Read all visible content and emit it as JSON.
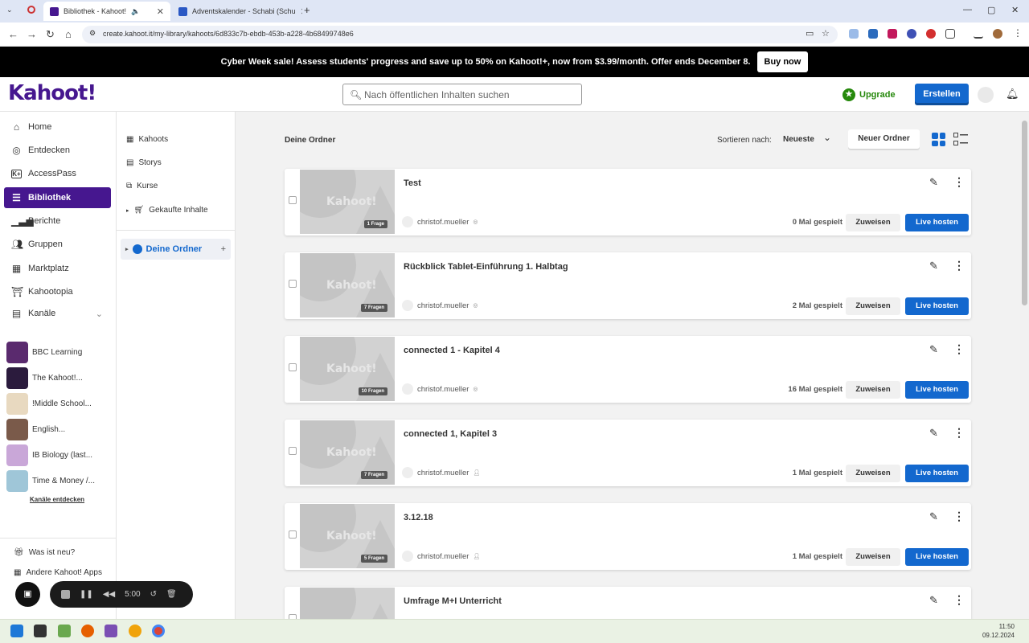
{
  "browser": {
    "tabs": [
      {
        "title": "Bibliothek - Kahoot!",
        "active": true
      },
      {
        "title": "Adventskalender - Schabi (Schu",
        "active": false
      }
    ],
    "url": "create.kahoot.it/my-library/kahoots/6d833c7b-ebdb-453b-a228-4b68499748e6"
  },
  "promo": {
    "text": "Cyber Week sale! Assess students' progress and save up to 50% on Kahoot!+, now from $3.99/month. Offer ends December 8.",
    "button": "Buy now"
  },
  "header": {
    "logo": "Kahoot!",
    "search_placeholder": "Nach öffentlichen Inhalten suchen",
    "upgrade": "Upgrade",
    "create": "Erstellen"
  },
  "leftnav": {
    "items": [
      {
        "label": "Home",
        "icon": "home-icon"
      },
      {
        "label": "Entdecken",
        "icon": "compass-icon"
      },
      {
        "label": "AccessPass",
        "icon": "accesspass-icon"
      },
      {
        "label": "Bibliothek",
        "icon": "list-icon",
        "active": true
      },
      {
        "label": "Berichte",
        "icon": "bar-chart-icon"
      },
      {
        "label": "Gruppen",
        "icon": "group-icon"
      },
      {
        "label": "Marktplatz",
        "icon": "store-icon"
      },
      {
        "label": "Kahootopia",
        "icon": "landmark-icon"
      },
      {
        "label": "Kanäle",
        "icon": "channels-icon"
      }
    ],
    "channels": [
      {
        "label": "BBC Learning",
        "color": "#5a2a6e"
      },
      {
        "label": "The Kahoot!...",
        "color": "#2b1b3d"
      },
      {
        "label": "!Middle School...",
        "color": "#e8d9c0"
      },
      {
        "label": "English...",
        "color": "#7a5a4a"
      },
      {
        "label": "IB Biology (last...",
        "color": "#c9a7d8"
      },
      {
        "label": "Time & Money /...",
        "color": "#9fc6d8"
      }
    ],
    "channels_link": "Kanäle entdecken",
    "whats_new": "Was ist neu?",
    "other_apps": "Andere Kahoot! Apps"
  },
  "libnav": {
    "items": [
      "Kahoots",
      "Storys",
      "Kurse",
      "Gekaufte Inhalte"
    ],
    "folder": "Deine Ordner"
  },
  "main": {
    "section_title": "Deine Ordner",
    "sort_label": "Sortieren nach:",
    "sort_value": "Neueste",
    "new_folder": "Neuer Ordner",
    "assign_label": "Zuweisen",
    "host_label": "Live hosten",
    "watermark": "Kahoot!",
    "cards": [
      {
        "title": "Test",
        "questions": "1 Frage",
        "owner": "christof.mueller",
        "plays": "0 Mal gespielt",
        "visibility": "globe-icon"
      },
      {
        "title": "Rückblick Tablet-Einführung 1. Halbtag",
        "questions": "7 Fragen",
        "owner": "christof.mueller",
        "plays": "2 Mal gespielt",
        "visibility": "globe-icon"
      },
      {
        "title": "connected 1 - Kapitel 4",
        "questions": "10 Fragen",
        "owner": "christof.mueller",
        "plays": "16 Mal gespielt",
        "visibility": "globe-icon"
      },
      {
        "title": "connected 1, Kapitel 3",
        "questions": "7 Fragen",
        "owner": "christof.mueller",
        "plays": "1 Mal gespielt",
        "visibility": "person-icon"
      },
      {
        "title": "3.12.18",
        "questions": "5 Fragen",
        "owner": "christof.mueller",
        "plays": "1 Mal gespielt",
        "visibility": "person-icon"
      },
      {
        "title": "Umfrage M+I Unterricht",
        "questions": "",
        "owner": "",
        "plays": "",
        "visibility": ""
      }
    ]
  },
  "recorder": {
    "time": "5:00"
  },
  "taskbar": {
    "time": "11:50",
    "date": "09.12.2024"
  }
}
